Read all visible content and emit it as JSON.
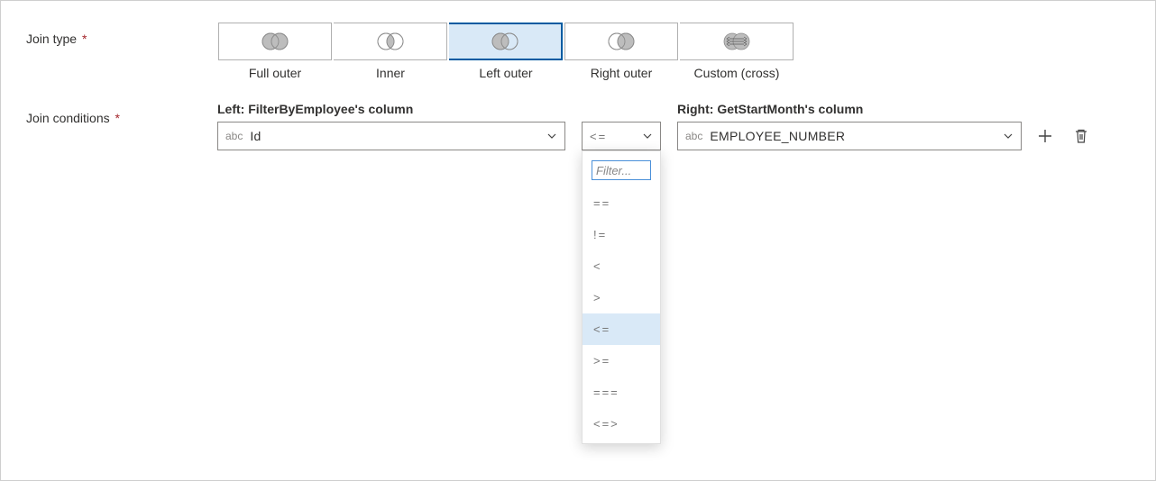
{
  "labels": {
    "joinType": "Join type",
    "joinConditions": "Join conditions"
  },
  "joinTypes": [
    {
      "key": "full",
      "label": "Full outer"
    },
    {
      "key": "inner",
      "label": "Inner"
    },
    {
      "key": "left",
      "label": "Left outer"
    },
    {
      "key": "right",
      "label": "Right outer"
    },
    {
      "key": "cross",
      "label": "Custom (cross)"
    }
  ],
  "selectedJoinType": "left",
  "condHeaders": {
    "left": "Left: FilterByEmployee's column",
    "right": "Right: GetStartMonth's column"
  },
  "condRow": {
    "leftPrefix": "abc",
    "leftValue": "Id",
    "operator": "<=",
    "rightPrefix": "abc",
    "rightValue": "EMPLOYEE_NUMBER"
  },
  "opFilter": {
    "placeholder": "Filter..."
  },
  "operators": [
    "==",
    "!=",
    "<",
    ">",
    "<=",
    ">=",
    "===",
    "<=>"
  ],
  "selectedOperator": "<="
}
